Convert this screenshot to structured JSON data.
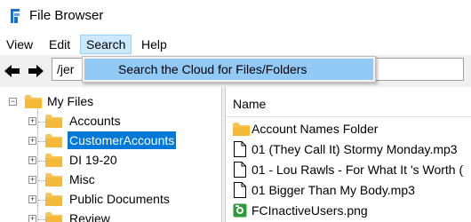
{
  "window": {
    "title": "File Browser",
    "icon": "app-logo-icon"
  },
  "menu": {
    "items": [
      "View",
      "Edit",
      "Search",
      "Help"
    ],
    "active": "Search"
  },
  "search_menu": {
    "items": [
      "Search the Cloud for Files/Folders"
    ]
  },
  "toolbar": {
    "back_icon": "back-arrow-icon",
    "forward_icon": "forward-arrow-icon",
    "path": "/jer"
  },
  "tree": {
    "root": "My Files",
    "children": [
      "Accounts",
      "CustomerAccounts",
      "DI 19-20",
      "Misc",
      "Public Documents",
      "Review"
    ],
    "selected": "CustomerAccounts"
  },
  "file_list": {
    "column_header": "Name",
    "items": [
      {
        "name": "Account Names Folder",
        "icon": "folder-icon"
      },
      {
        "name": "01 (They Call It) Stormy Monday.mp3",
        "icon": "file-icon"
      },
      {
        "name": "01 - Lou Rawls - For What It 's Worth (",
        "icon": "file-icon"
      },
      {
        "name": "01 Bigger Than My Body.mp3",
        "icon": "file-icon"
      },
      {
        "name": "FCInactiveUsers.png",
        "icon": "image-file-icon"
      }
    ]
  },
  "colors": {
    "selection": "#0078d7",
    "menu_highlight": "#cce8ff",
    "dropdown_highlight": "#91c9f7",
    "folder": "#f8c457"
  }
}
